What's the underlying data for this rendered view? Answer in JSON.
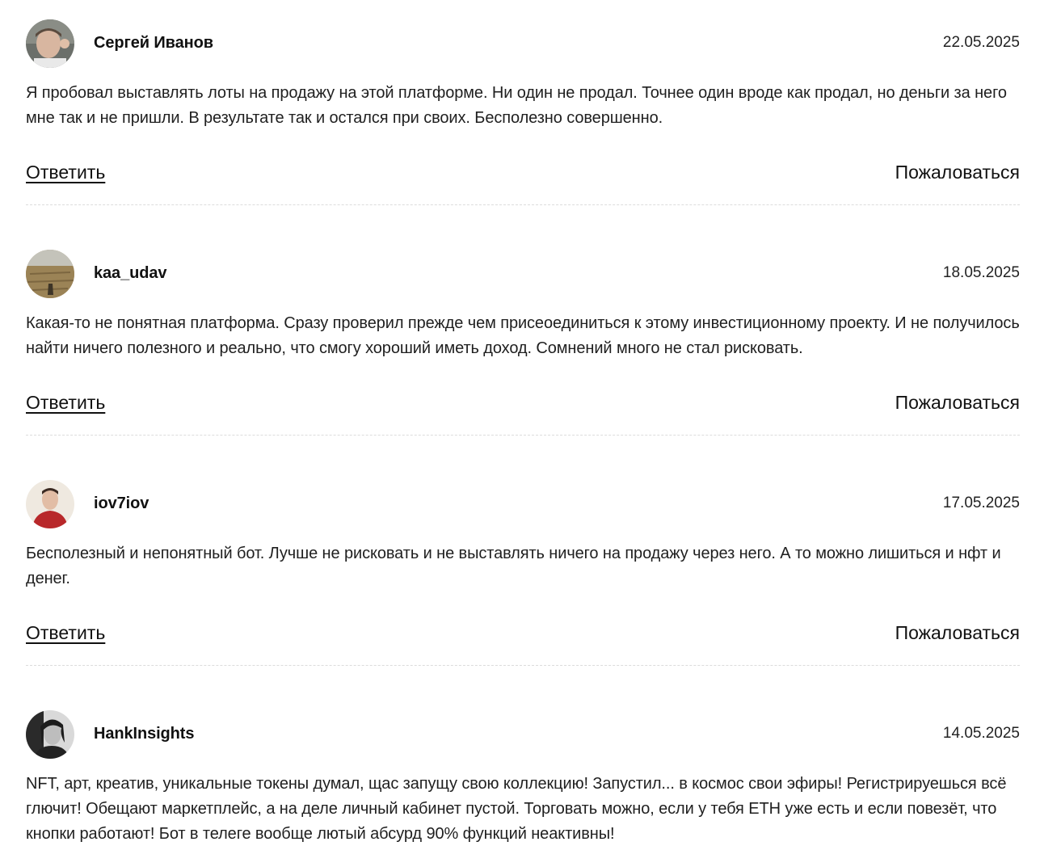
{
  "comments": [
    {
      "author": "Сергей Иванов",
      "date": "22.05.2025",
      "text": "Я пробовал выставлять лоты на продажу на этой платформе. Ни один не продал. Точнее один вроде как продал, но деньги за него мне так и не пришли. В результате так и остался при своих. Бесполезно совершенно.",
      "reply_label": "Ответить",
      "complain_label": "Пожаловаться"
    },
    {
      "author": "kaa_udav",
      "date": "18.05.2025",
      "text": "Какая-то не понятная платформа. Сразу проверил прежде чем присеоединиться к этому инвестиционному проекту. И не получилось найти ничего полезного и реально, что смогу хороший иметь доход. Сомнений много не стал рисковать.",
      "reply_label": "Ответить",
      "complain_label": "Пожаловаться"
    },
    {
      "author": "iov7iov",
      "date": "17.05.2025",
      "text": "Бесполезный и непонятный бот. Лучше не рисковать и не выставлять ничего на продажу через него. А то можно лишиться и нфт и денег.",
      "reply_label": "Ответить",
      "complain_label": "Пожаловаться"
    },
    {
      "author": "HankInsights",
      "date": "14.05.2025",
      "text": "NFT, арт, креатив, уникальные токены думал, щас запущу свою коллекцию! Запустил... в космос свои эфиры! Регистрируешься всё глючит! Обещают маркетплейс, а на деле личный кабинет пустой. Торговать можно, если у тебя ETH уже есть и если повезёт, что кнопки работают! Бот в телеге вообще лютый абсурд 90% функций неактивны!"
    }
  ]
}
